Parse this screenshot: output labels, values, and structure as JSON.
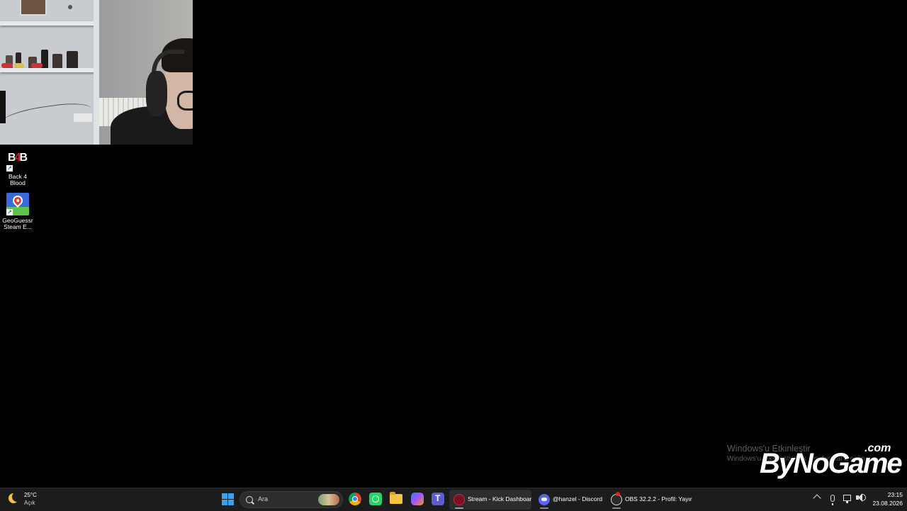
{
  "desktop": {
    "icons": [
      {
        "label": "Back 4 Blood",
        "icon": "back-4-blood-icon",
        "art_text_left": "B",
        "art_text_mid": "4",
        "art_text_right": "B"
      },
      {
        "label": "GeoGuessr Steam E...",
        "icon": "geoguessr-icon"
      }
    ],
    "activation": {
      "title": "Windows'u Etkinleştir",
      "subtitle": "Windows'u etkinleştirmek için Ayarlar'a gidin."
    },
    "watermark": {
      "main": "ByNoGame",
      "suffix": ".com"
    }
  },
  "taskbar": {
    "weather": {
      "temperature": "25°C",
      "condition": "Açık",
      "icon": "moon-icon"
    },
    "search_placeholder": "Ara",
    "pinned": [
      "chrome-icon",
      "whatsapp-icon",
      "file-explorer-icon",
      "copilot-icon",
      "teams-icon"
    ],
    "apps": [
      {
        "label": "Stream - Kick Dashboar",
        "icon": "kick-icon",
        "active": true
      },
      {
        "label": "@hanzel - Discord",
        "icon": "discord-icon",
        "active": false
      },
      {
        "label": "OBS 32.2.2 - Profil: Yayır",
        "icon": "obs-icon",
        "active": false
      }
    ],
    "tray": [
      "chevron-up-icon",
      "microphone-icon",
      "network-icon",
      "volume-icon"
    ],
    "clock": {
      "time": "23:15",
      "date": "23.08.2026"
    }
  },
  "colors": {
    "accent": "#3aa0f3",
    "taskbar_bg": "#1c1c1c",
    "desktop_bg": "#000000"
  }
}
